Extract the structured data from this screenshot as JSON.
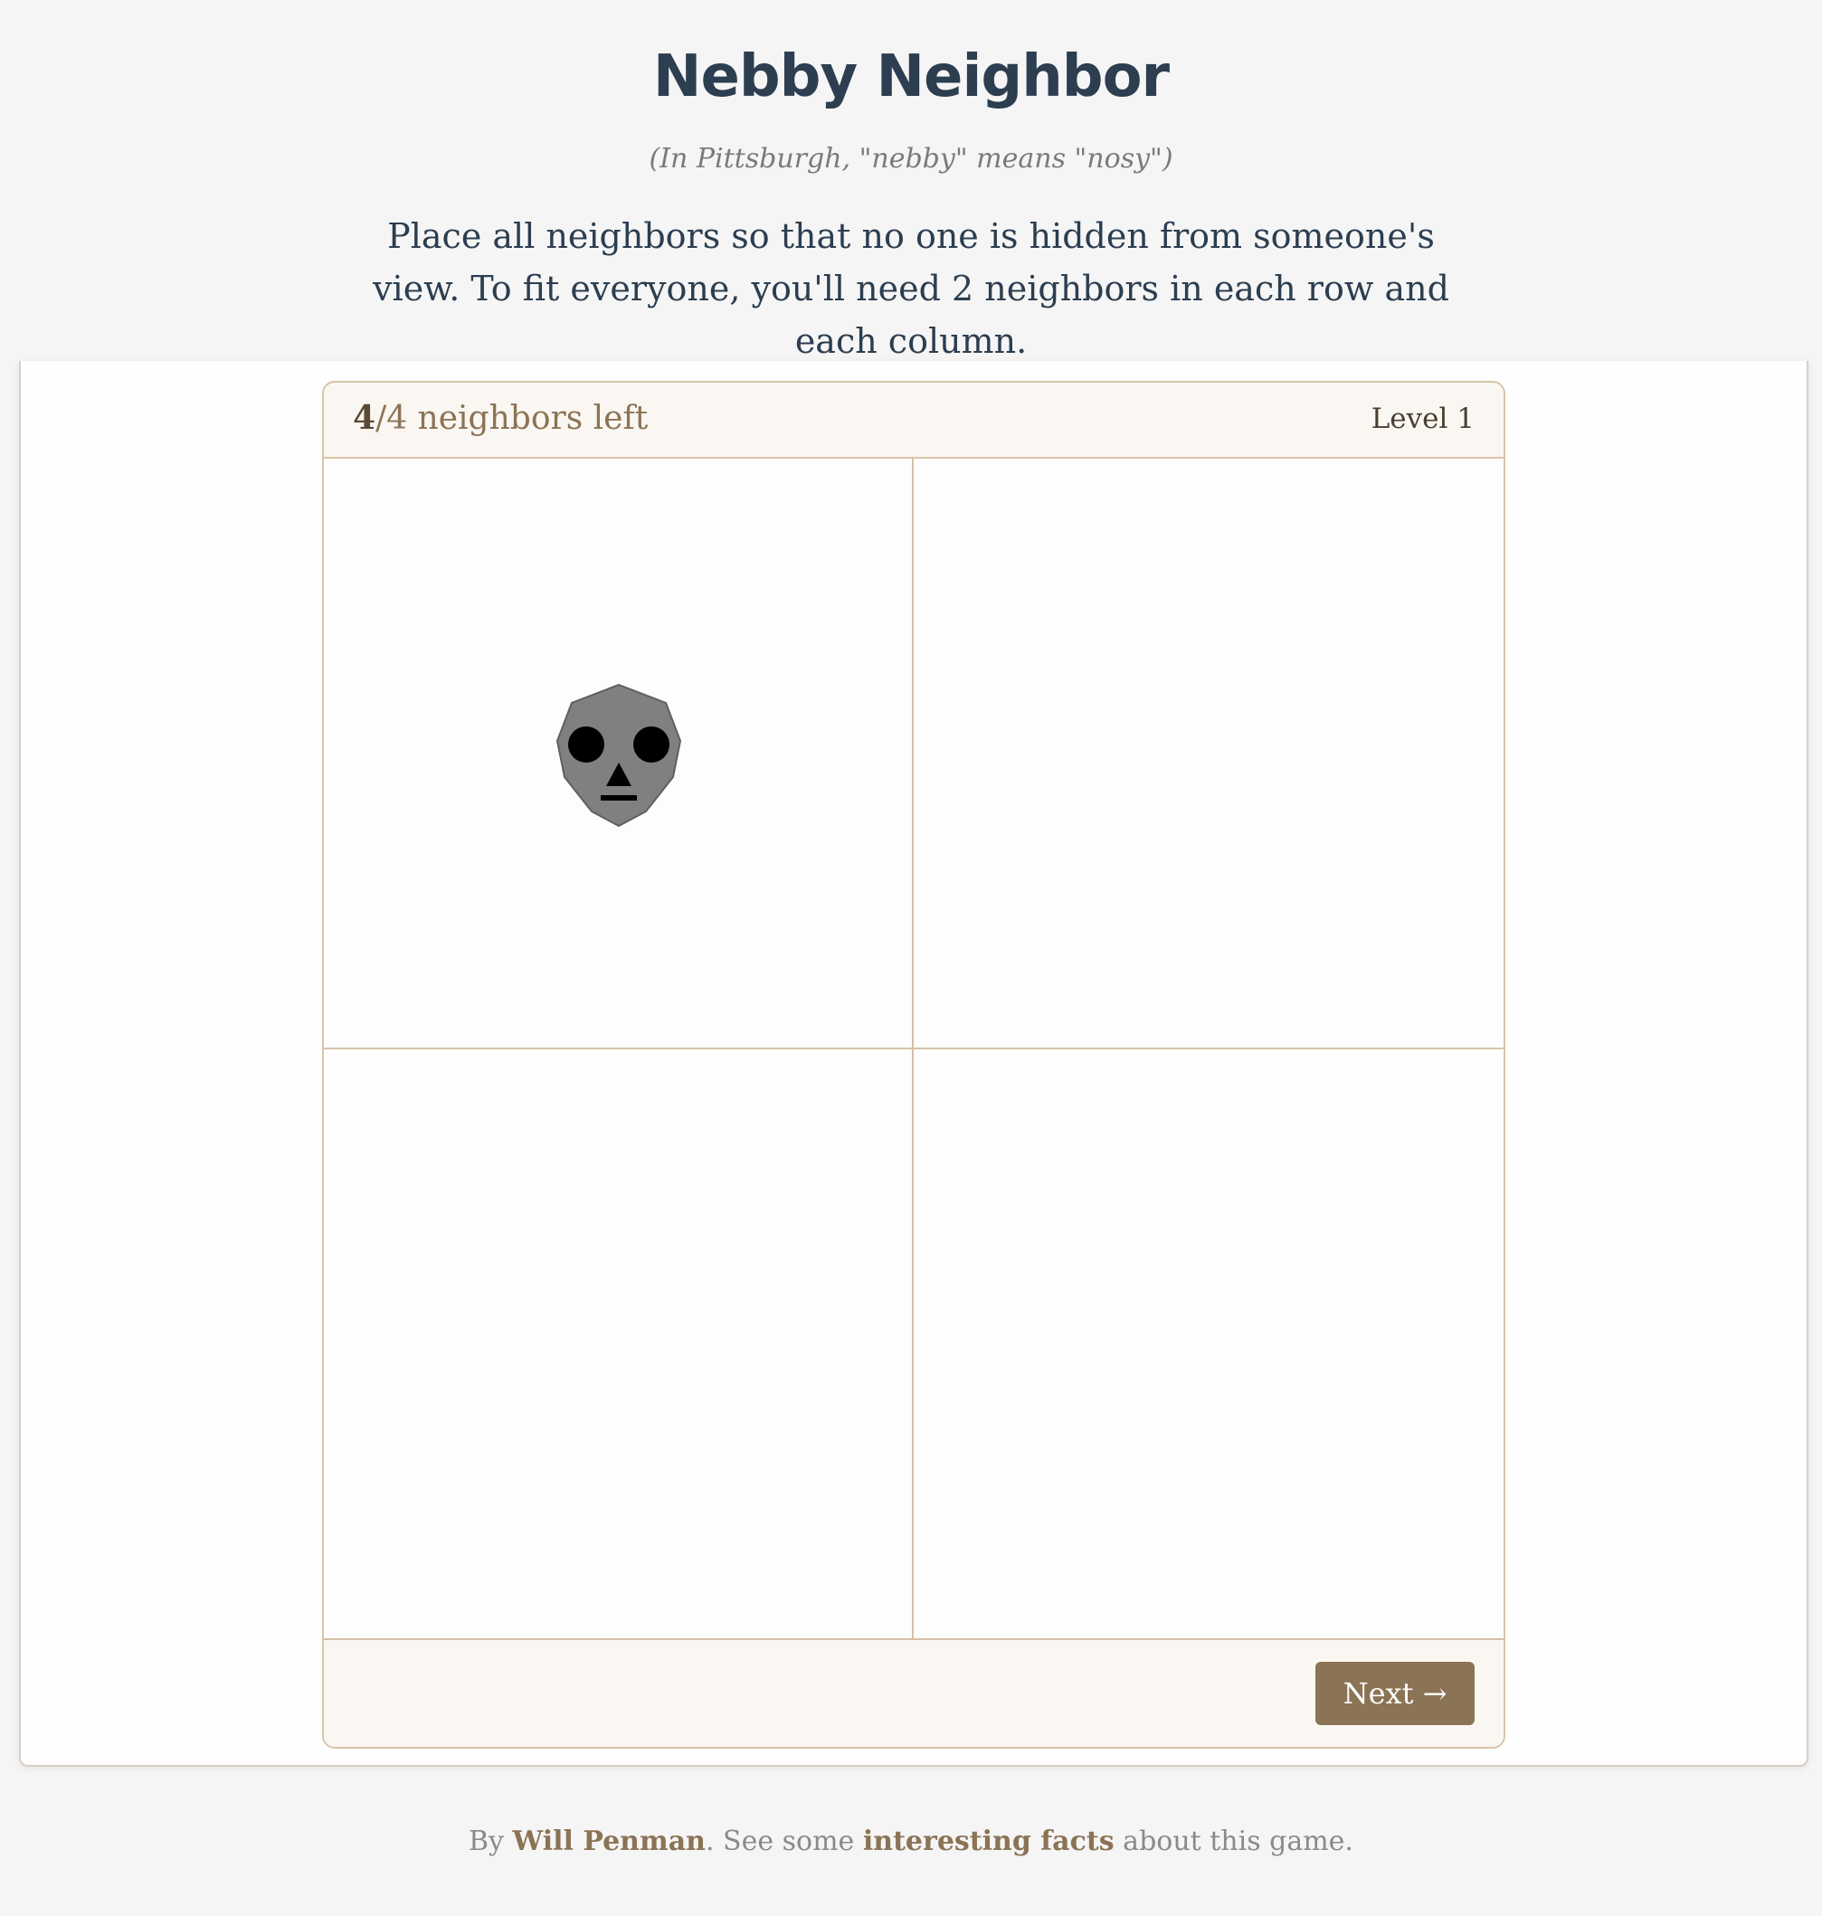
{
  "header": {
    "title": "Nebby Neighbor",
    "subtitle": "(In Pittsburgh, \"nebby\" means \"nosy\")",
    "instructions": "Place all neighbors so that no one is hidden from someone's view. To fit everyone, you'll need 2 neighbors in each row and each column."
  },
  "game": {
    "neighbors_remaining": "4",
    "neighbors_total_text": "/4 neighbors left",
    "level": "Level 1",
    "grid_rows": 2,
    "grid_cols": 2,
    "placed_pieces": [
      {
        "row": 0,
        "col": 0,
        "icon": "gray-neighbor-face-icon",
        "color": "#808080"
      }
    ],
    "next_label": "Next →"
  },
  "footer": {
    "by": "By ",
    "author": "Will Penman",
    "middle": ". See some ",
    "facts_link": "interesting facts",
    "end": " about this game."
  },
  "colors": {
    "accent": "#8b7355",
    "border": "#d9c4a8",
    "title": "#2c3e50"
  }
}
